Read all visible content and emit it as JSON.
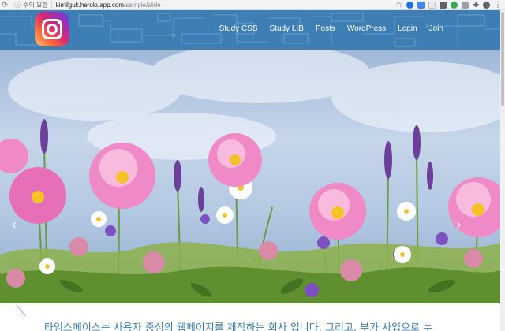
{
  "browser": {
    "security_label": "주의 요함",
    "url_host": "kimilguk.herokuapp.com",
    "url_path": "/sample/slide"
  },
  "site": {
    "logo_icon": "instagram-logo-icon",
    "menu": [
      {
        "label": "Study CSS"
      },
      {
        "label": "Study LIB"
      },
      {
        "label": "Posts"
      },
      {
        "label": "WordPress"
      },
      {
        "label": "Login"
      },
      {
        "label": "Join"
      }
    ]
  },
  "slider": {
    "prev_icon": "chevron-left-icon",
    "next_icon": "chevron-right-icon",
    "prev_glyph": "‹",
    "next_glyph": "›"
  },
  "intro": {
    "text": "타임스페이스는 사용자 중심의 웹페이지를 제작하는 회사 입니다. 그리고, 부가 사업으로 누"
  },
  "colors": {
    "header_bg": "#3d7fb5",
    "intro_text": "#3d7fb5"
  }
}
